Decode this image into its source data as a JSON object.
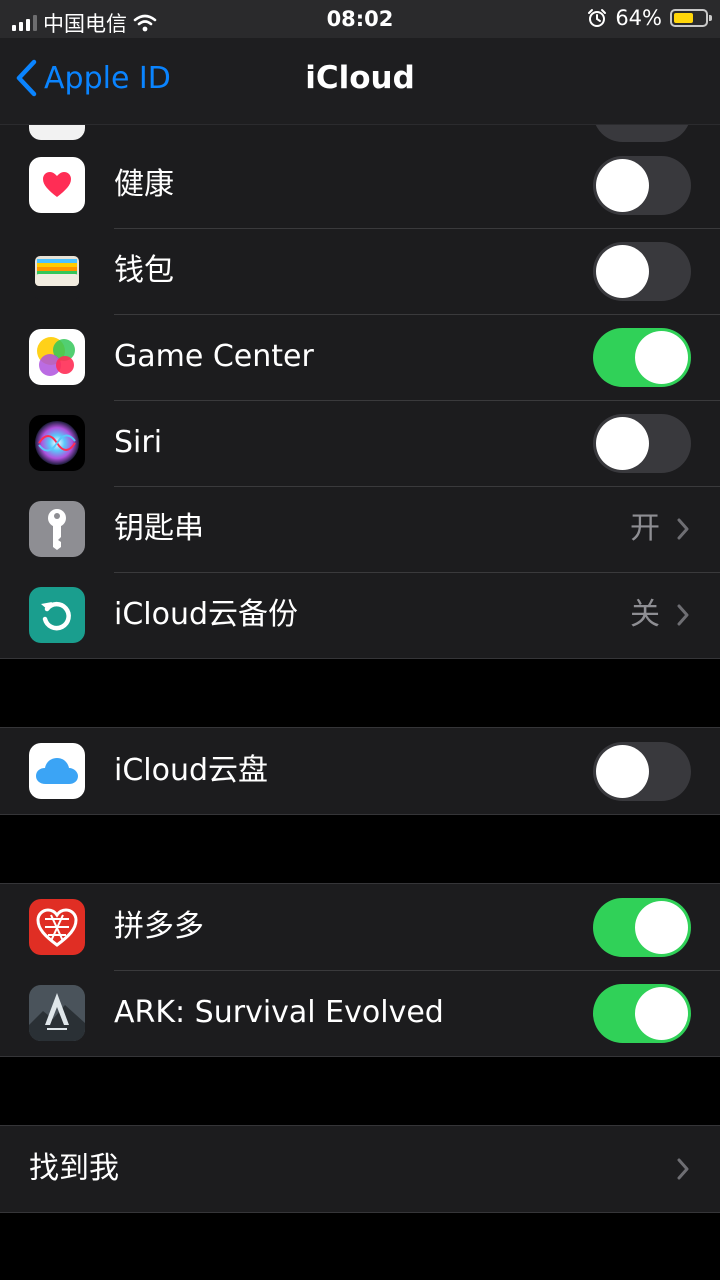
{
  "status_bar": {
    "carrier": "中国电信",
    "time": "08:02",
    "battery_percent": "64%",
    "battery_level": 0.64,
    "battery_color": "#ffd60a"
  },
  "nav": {
    "back_label": "Apple ID",
    "title": "iCloud",
    "accent": "#0a84ff"
  },
  "apps": [
    {
      "label": "健康",
      "icon": "health-heart-icon",
      "toggle": false
    },
    {
      "label": "钱包",
      "icon": "wallet-icon",
      "toggle": false
    },
    {
      "label": "Game Center",
      "icon": "game-center-icon",
      "toggle": true
    },
    {
      "label": "Siri",
      "icon": "siri-icon",
      "toggle": false
    },
    {
      "label": "钥匙串",
      "icon": "keychain-key-icon",
      "value": "开"
    },
    {
      "label": "iCloud云备份",
      "icon": "icloud-backup-icon",
      "value": "关"
    }
  ],
  "drive": {
    "label": "iCloud云盘",
    "icon": "icloud-drive-cloud-icon",
    "toggle": false
  },
  "third_party": [
    {
      "label": "拼多多",
      "icon": "pinduoduo-icon",
      "toggle": true
    },
    {
      "label": "ARK: Survival Evolved",
      "icon": "ark-survival-evolved-icon",
      "toggle": true
    }
  ],
  "find_my": {
    "label": "找到我"
  },
  "colors": {
    "toggle_on": "#30d158",
    "toggle_off": "#39393d",
    "row_bg": "#1c1c1e"
  }
}
